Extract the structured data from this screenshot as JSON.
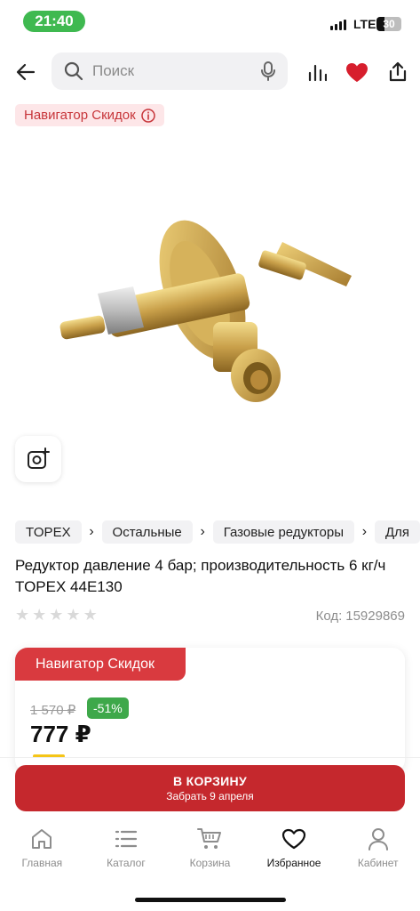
{
  "status_bar": {
    "time": "21:40",
    "network": "LTE",
    "battery": "30"
  },
  "search": {
    "placeholder": "Поиск"
  },
  "badge": {
    "label": "Навигатор Скидок"
  },
  "breadcrumbs": [
    "TOPEX",
    "Остальные",
    "Газовые редукторы",
    "Для"
  ],
  "product": {
    "title": "Редуктор давление 4 бар; производительность 6 кг/ч TOPEX 44E130",
    "rating": 0,
    "code_label": "Код:",
    "code": "15929869"
  },
  "price_card": {
    "tab_label": "Навигатор Скидок",
    "old_price": "1 570 ₽",
    "discount": "-51%",
    "price": "777 ₽"
  },
  "cart_button": {
    "label": "В КОРЗИНУ",
    "subtitle": "Забрать 9 апреля"
  },
  "bottom_nav": [
    {
      "label": "Главная",
      "icon": "home-icon"
    },
    {
      "label": "Каталог",
      "icon": "catalog-icon"
    },
    {
      "label": "Корзина",
      "icon": "cart-icon"
    },
    {
      "label": "Избранное",
      "icon": "heart-outline-icon",
      "active": true
    },
    {
      "label": "Кабинет",
      "icon": "user-icon"
    }
  ],
  "colors": {
    "accent": "#c5282d",
    "badge_bg": "#fde6e8",
    "discount": "#3ea84a",
    "favorite": "#d71e2d"
  }
}
